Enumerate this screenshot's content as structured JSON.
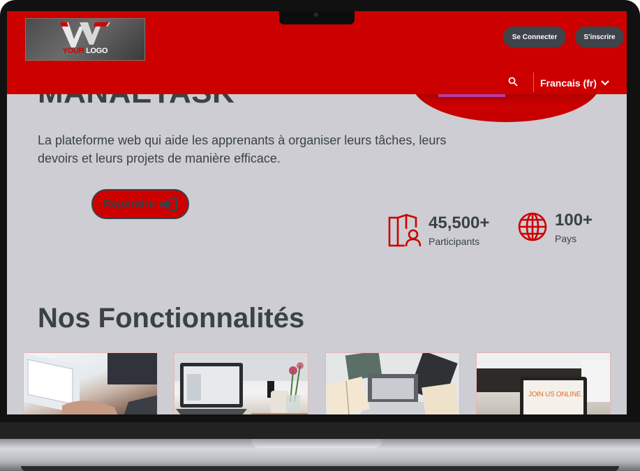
{
  "header": {
    "logo": {
      "your": "YOUR",
      "logo": " LOGO"
    },
    "login_label": "Se Connecter",
    "signup_label": "S'inscrire",
    "language": "Francais (fr)"
  },
  "hero": {
    "title": "MANAETASK",
    "description": "La  plateforme web qui aide les apprenants à organiser leurs tâches, leurs devoirs et leurs projets de manière efficace.",
    "join_label": "Rejoindre"
  },
  "stats": [
    {
      "value": "45,500+",
      "label": "Participants",
      "icon": "book-user-icon"
    },
    {
      "value": "100+",
      "label": "Pays",
      "icon": "globe-icon"
    }
  ],
  "features": {
    "title": "Nos Fonctionnalités",
    "cards": [
      {
        "image": "laptop-typing-photo"
      },
      {
        "image": "laptop-desk-coffee-photo"
      },
      {
        "image": "laptop-books-photo"
      },
      {
        "image": "join-us-online-tablet-photo",
        "caption": "JOIN US ONLINE."
      }
    ]
  },
  "colors": {
    "brand_red": "#cd0000",
    "dark": "#3a4149",
    "background": "#cdcdd3",
    "button_dark": "#3e444a"
  }
}
